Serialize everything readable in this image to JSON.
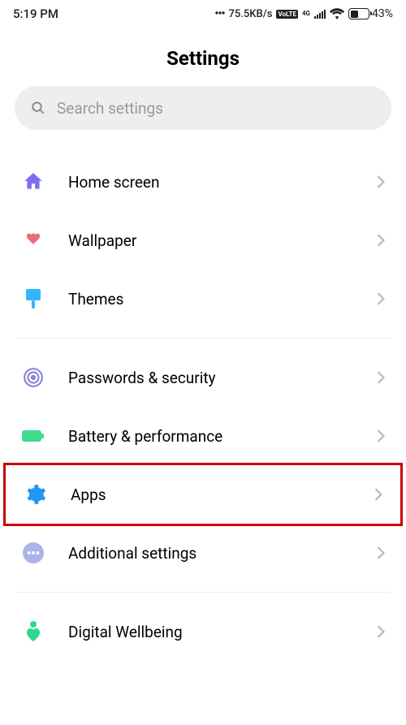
{
  "status": {
    "time": "5:19 PM",
    "net_speed": "75.5KB/s",
    "battery_pct": "43%",
    "battery_fill": "43%"
  },
  "header": {
    "title": "Settings"
  },
  "search": {
    "placeholder": "Search settings"
  },
  "items": {
    "home": "Home screen",
    "wallpaper": "Wallpaper",
    "themes": "Themes",
    "passwords": "Passwords & security",
    "battery": "Battery & performance",
    "apps": "Apps",
    "additional": "Additional settings",
    "wellbeing": "Digital Wellbeing"
  },
  "colors": {
    "home": "#7b6ef0",
    "wallpaper": "#e86b7f",
    "themes": "#33b5ff",
    "passwords": "#8a85d6",
    "battery": "#3edc8a",
    "apps": "#2196f3",
    "additional": "#a9b4ea",
    "wellbeing": "#2ed88c"
  }
}
